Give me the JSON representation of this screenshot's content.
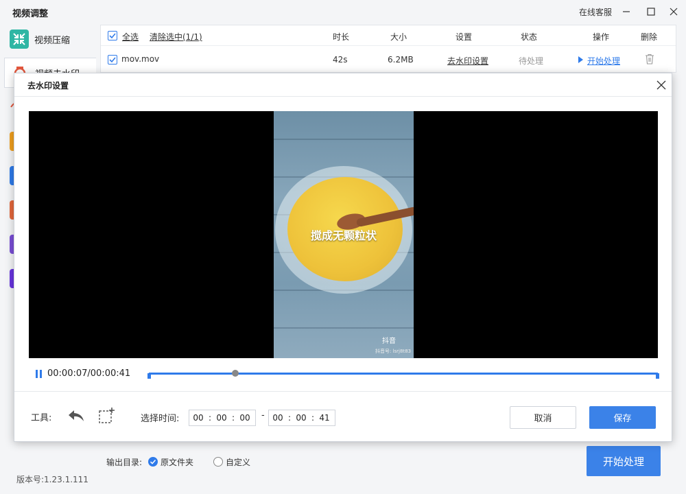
{
  "window": {
    "title": "视频调整",
    "support_label": "在线客服"
  },
  "sidebar": {
    "items": [
      {
        "label": "视频压缩",
        "icon": "compress-icon"
      },
      {
        "label": "视频去水印",
        "icon": "watermark-icon",
        "active": true
      }
    ]
  },
  "table": {
    "select_all_label": "全选",
    "clear_selection_label": "清除选中(1/1)",
    "columns": [
      "时长",
      "大小",
      "设置",
      "状态",
      "操作",
      "删除"
    ],
    "rows": [
      {
        "name": "mov.mov",
        "duration": "42s",
        "size": "6.2MB",
        "setting": "去水印设置",
        "status": "待处理",
        "action": "开始处理"
      }
    ]
  },
  "output": {
    "label": "输出目录:",
    "options": [
      "原文件夹",
      "自定义"
    ],
    "selected": "原文件夹"
  },
  "start_button_label": "开始处理",
  "version": "版本号:1.23.1.111",
  "modal": {
    "title": "去水印设置",
    "video_caption": "搅成无颗粒状",
    "video_watermark_logo": "抖音",
    "video_watermark_id": "抖音号: lsrj8t83",
    "current_time": "00:00:07/00:00:41",
    "progress_fraction": 0.17,
    "tools_label": "工具:",
    "time_select_label": "选择时间:",
    "start_time": {
      "h": "00",
      "m": "00",
      "s": "00"
    },
    "end_time": {
      "h": "00",
      "m": "00",
      "s": "41"
    },
    "separator": ":",
    "range_dash": "-",
    "cancel_label": "取消",
    "save_label": "保存"
  },
  "colors": {
    "accent": "#3b82e8",
    "link": "#2f7bea"
  }
}
